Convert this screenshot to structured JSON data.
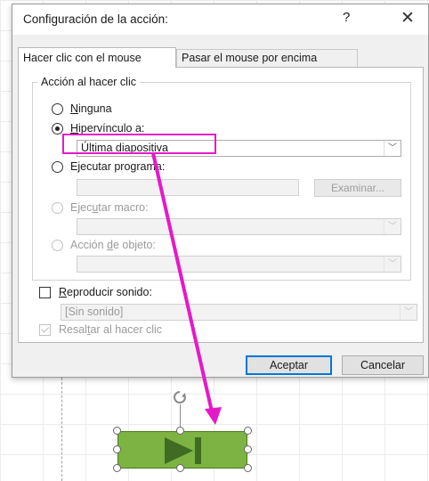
{
  "dialog": {
    "title": "Configuración de la acción:",
    "help": "?",
    "close": "✕"
  },
  "tabs": [
    {
      "label": "Hacer clic con el mouse",
      "active": true
    },
    {
      "label": "Pasar el mouse por encima",
      "active": false
    }
  ],
  "group": {
    "label": "Acción al hacer clic"
  },
  "options": {
    "ninguna": {
      "label_u": "N",
      "label_rest": "inguna",
      "checked": false
    },
    "hipervinculo": {
      "label_u": "H",
      "label_rest": "ipervínculo a:",
      "checked": true
    },
    "hipervinculo_value": "Última diapositiva",
    "ejecutar_programa": {
      "label_pre": "E",
      "label_u": "j",
      "label_rest": "ecutar programa:",
      "checked": false
    },
    "examinar": "Examinar...",
    "ejecutar_macro": {
      "label_pre": "Ejec",
      "label_u": "u",
      "label_rest": "tar macro:",
      "disabled": true
    },
    "accion_objeto": {
      "label_pre": "Acción ",
      "label_u": "d",
      "label_rest": "e objeto:",
      "disabled": true
    }
  },
  "sound": {
    "label_u": "R",
    "label_rest": "eproducir sonido:",
    "checked": false,
    "value": "[Sin sonido]"
  },
  "highlight_click": {
    "label_pre": "Resal",
    "label_u": "t",
    "label_rest": "ar al hacer clic",
    "checked": true,
    "disabled": true
  },
  "buttons": {
    "ok": "Aceptar",
    "cancel": "Cancelar"
  },
  "annotation": {
    "color": "#e619c8"
  },
  "slide": {
    "action_button_icon": "play-end-icon",
    "action_button_color": "#7cb342"
  }
}
